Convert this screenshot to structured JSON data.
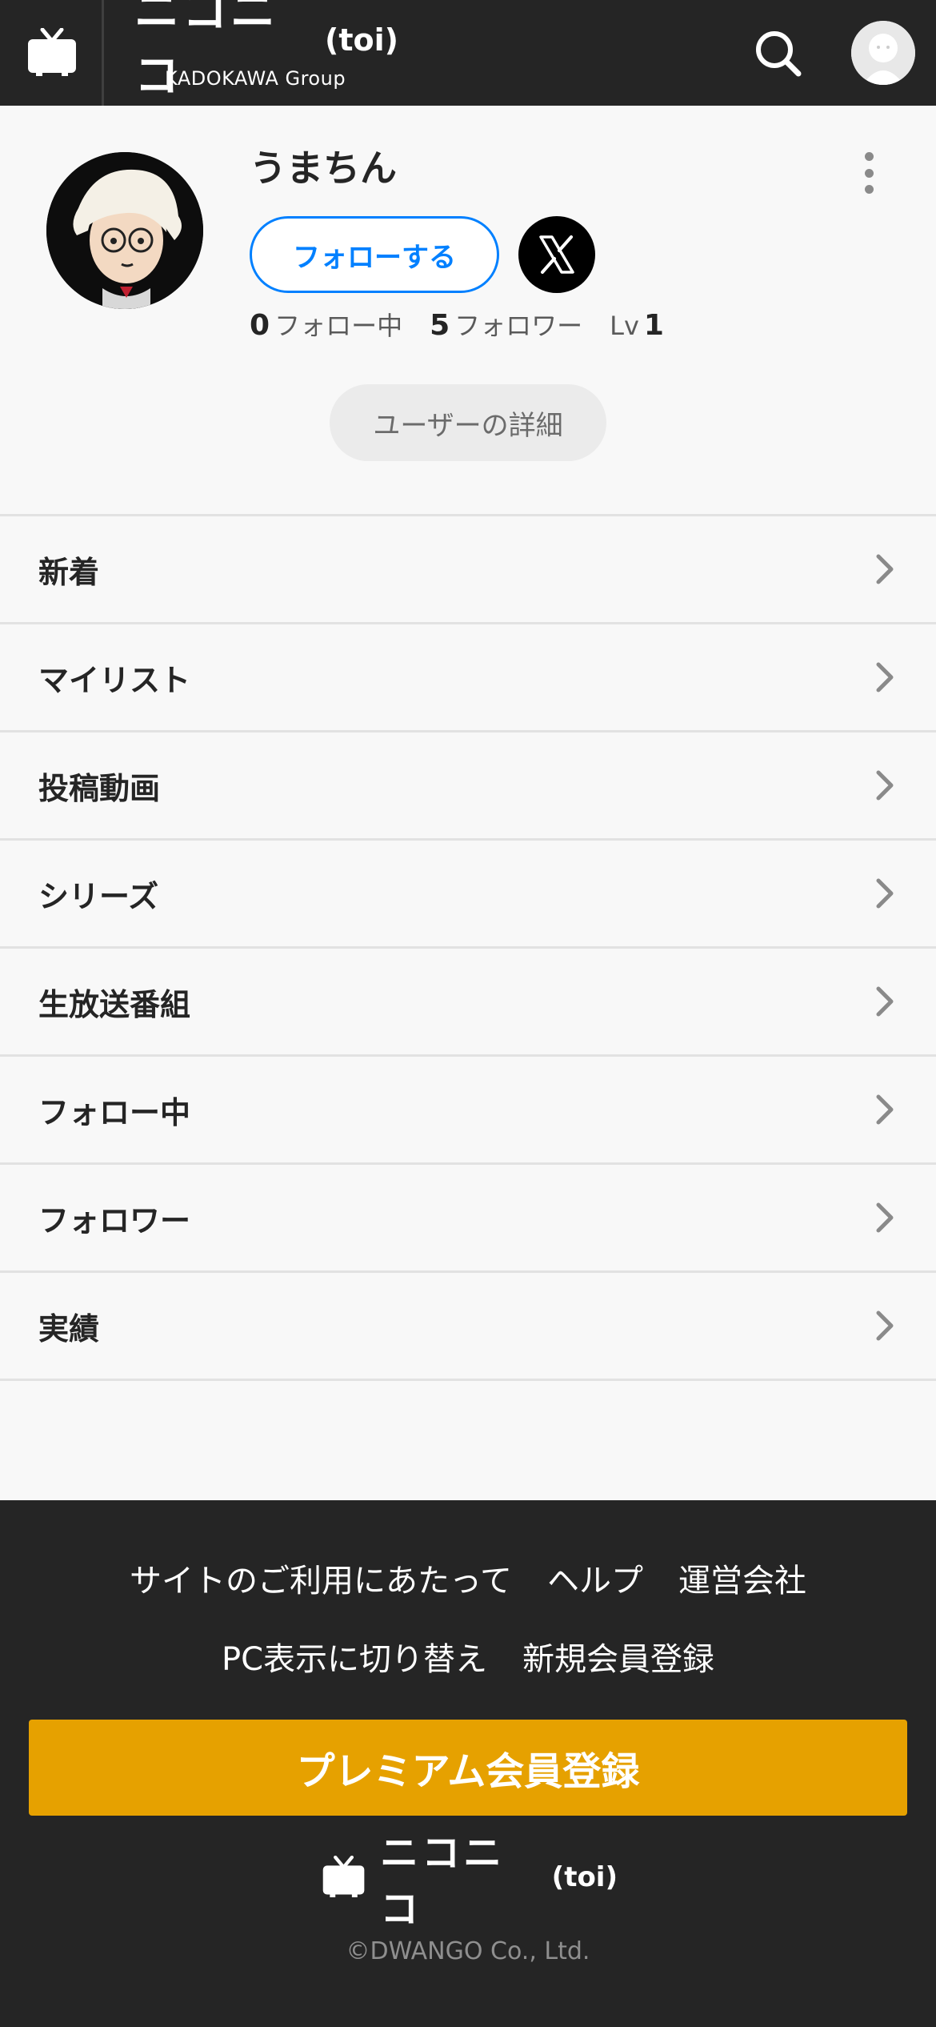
{
  "header": {
    "logo_text": "ニコニコ",
    "logo_suffix": "(toi)",
    "logo_sub": "KADOKAWA Group"
  },
  "profile": {
    "username": "うまちん",
    "follow_label": "フォローする",
    "following_count": "0",
    "following_label": "フォロー中",
    "follower_count": "5",
    "follower_label": "フォロワー",
    "level_label": "Lv",
    "level_value": "1",
    "details_label": "ユーザーの詳細"
  },
  "menu": {
    "items": [
      {
        "label": "新着"
      },
      {
        "label": "マイリスト"
      },
      {
        "label": "投稿動画"
      },
      {
        "label": "シリーズ"
      },
      {
        "label": "生放送番組"
      },
      {
        "label": "フォロー中"
      },
      {
        "label": "フォロワー"
      },
      {
        "label": "実績"
      }
    ]
  },
  "footer": {
    "links_row1": [
      "サイトのご利用にあたって",
      "ヘルプ",
      "運営会社"
    ],
    "links_row2": [
      "PC表示に切り替え",
      "新規会員登録"
    ],
    "premium_label": "プレミアム会員登録",
    "logo_text": "ニコニコ",
    "logo_suffix": "(toi)",
    "copyright": "©DWANGO Co., Ltd."
  },
  "colors": {
    "header_bg": "#252525",
    "accent_blue": "#0080ff",
    "premium_gold": "#e6a100"
  }
}
